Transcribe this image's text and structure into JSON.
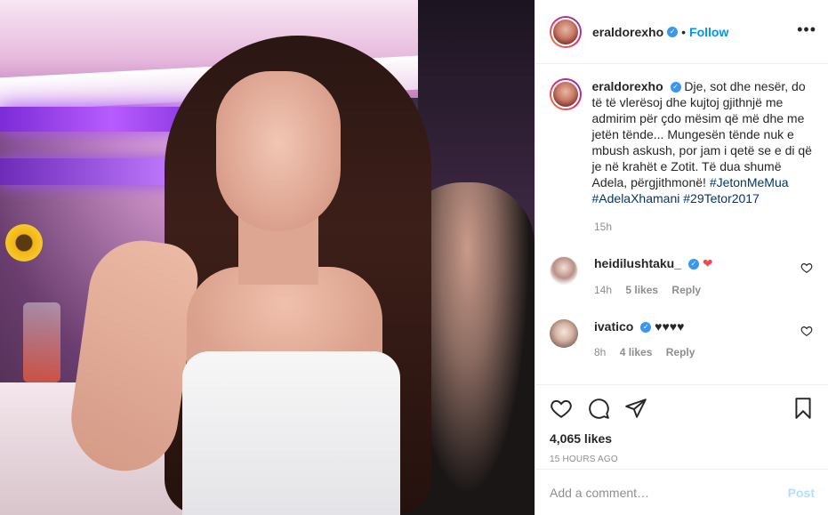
{
  "post": {
    "username": "eraldorexho",
    "follow_label": "Follow",
    "dot": "•",
    "more_label": "•••",
    "caption": {
      "username": "eraldorexho",
      "text": "Dje, sot dhe nesër, do të të vlerësoj dhe kujtoj gjithnjë me admirim për çdo mësim që më dhe me jetën tënde... Mungesën tënde nuk e mbush askush, por jam i qetë se e di që je në krahët e Zotit. Të dua shumë Adela, përgjithmonë!",
      "hashtags": [
        "#JetonMeMua",
        "#AdelaXhamani",
        "#29Tetor2017"
      ],
      "time": "15h"
    },
    "comments": [
      {
        "username": "heidilushtaku_",
        "text": "",
        "emoji": "❤",
        "emoji_color": "#ed4956",
        "time": "14h",
        "likes": "5 likes",
        "reply": "Reply"
      },
      {
        "username": "ivatico",
        "text": "♥♥♥♥",
        "time": "8h",
        "likes": "4 likes",
        "reply": "Reply"
      }
    ],
    "likes": "4,065 likes",
    "timestamp": "15 HOURS AGO",
    "add_comment_placeholder": "Add a comment…",
    "post_label": "Post"
  },
  "icons": {
    "verified": "verified-icon",
    "like": "heart-icon",
    "comment": "comment-icon",
    "share": "paper-plane-icon",
    "save": "bookmark-icon",
    "more": "more-icon"
  },
  "colors": {
    "accent": "#0095f6",
    "verified": "#3897f0",
    "hashtag": "#00376b",
    "muted": "#8e8e8e",
    "post_disabled": "#b2dffc",
    "heart": "#ed4956"
  }
}
